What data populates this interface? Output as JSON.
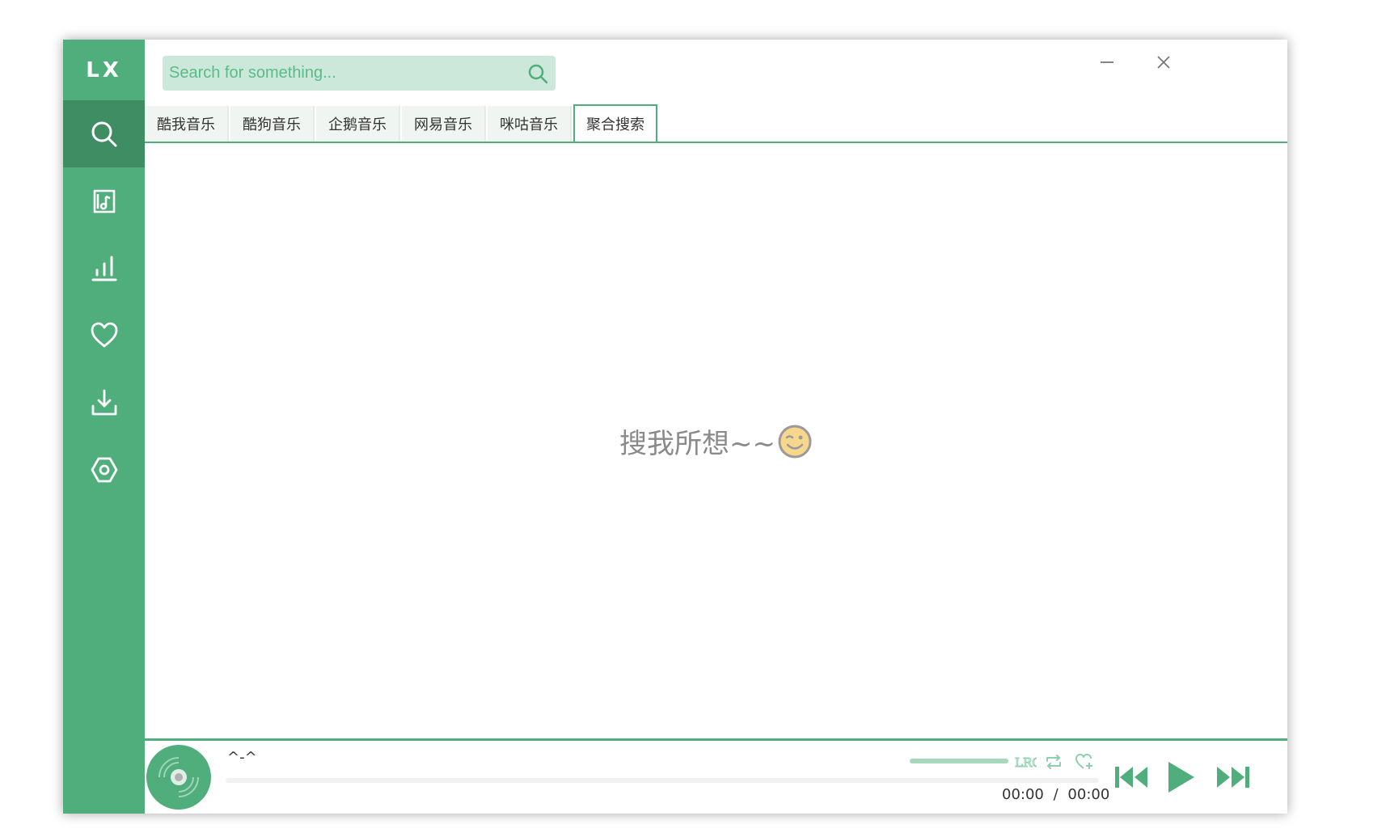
{
  "app": {
    "logo": "LX"
  },
  "colors": {
    "accent": "#4fae7b",
    "accent_dark": "#3f8d63",
    "search_bg": "#cbe8da"
  },
  "sidebar": {
    "items": [
      {
        "name": "search",
        "icon": "search-icon",
        "active": true
      },
      {
        "name": "songlist",
        "icon": "music-list-icon",
        "active": false
      },
      {
        "name": "leaderboard",
        "icon": "bar-chart-icon",
        "active": false
      },
      {
        "name": "favorites",
        "icon": "heart-icon",
        "active": false
      },
      {
        "name": "download",
        "icon": "download-icon",
        "active": false
      },
      {
        "name": "settings",
        "icon": "settings-icon",
        "active": false
      }
    ]
  },
  "search": {
    "placeholder": "Search for something..."
  },
  "window_controls": {
    "minimize": "minimize-icon",
    "close": "close-icon"
  },
  "tabs": [
    {
      "label": "酷我音乐",
      "active": false
    },
    {
      "label": "酷狗音乐",
      "active": false
    },
    {
      "label": "企鹅音乐",
      "active": false
    },
    {
      "label": "网易音乐",
      "active": false
    },
    {
      "label": "咪咕音乐",
      "active": false
    },
    {
      "label": "聚合搜索",
      "active": true
    }
  ],
  "content": {
    "empty_text": "搜我所想~~",
    "emoji": "😉"
  },
  "player": {
    "title": "^-^",
    "current_time": "00:00",
    "separator": "/",
    "total_time": "00:00",
    "progress": 0,
    "volume": 1.0,
    "icons": [
      "lyrics-icon",
      "repeat-icon",
      "add-favorite-icon",
      "previous-icon",
      "play-icon",
      "next-icon"
    ]
  }
}
